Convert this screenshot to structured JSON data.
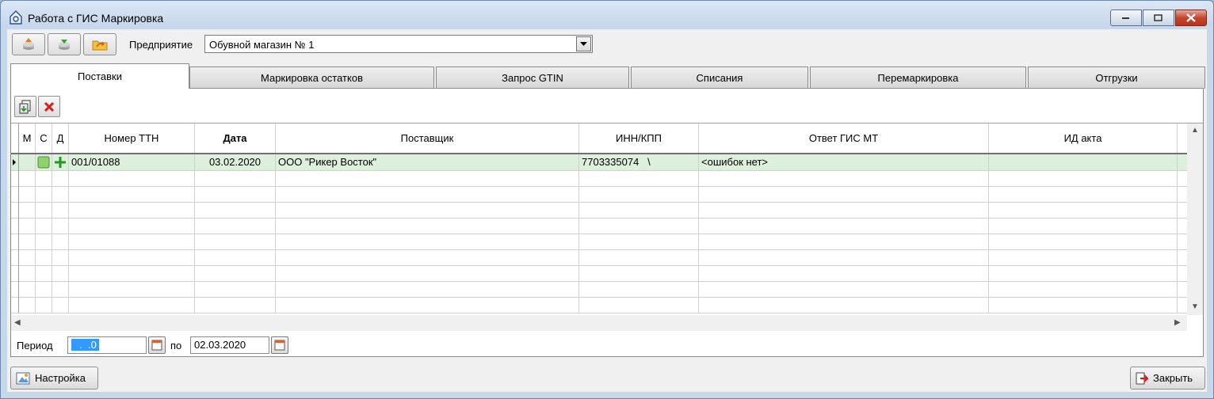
{
  "window": {
    "title": "Работа с ГИС Маркировка"
  },
  "header": {
    "enterprise_label": "Предприятие",
    "enterprise_value": "Обувной магазин № 1"
  },
  "tabs": [
    {
      "label": "Поставки",
      "active": true
    },
    {
      "label": "Маркировка остатков"
    },
    {
      "label": "Запрос GTIN"
    },
    {
      "label": "Списания"
    },
    {
      "label": "Перемаркировка"
    },
    {
      "label": "Отгрузки"
    }
  ],
  "table": {
    "columns": [
      "М",
      "С",
      "Д",
      "Номер ТТН",
      "Дата",
      "Поставщик",
      "ИНН/КПП",
      "Ответ ГИС МТ",
      "ИД акта"
    ],
    "rows": [
      {
        "ttn": "001/01088",
        "date": "03.02.2020",
        "supplier": "ООО \"Рикер Восток\"",
        "inn": "7703335074   \\",
        "answer": "<ошибок нет>",
        "act_id": ""
      }
    ]
  },
  "period": {
    "label": "Период",
    "from": "  .  .0",
    "to_label": "по",
    "to": "02.03.2020"
  },
  "footer": {
    "settings_label": "Настройка",
    "close_label": "Закрыть"
  },
  "colors": {
    "selected_row": "#dcf0dc",
    "accent_close": "#c6452c"
  }
}
